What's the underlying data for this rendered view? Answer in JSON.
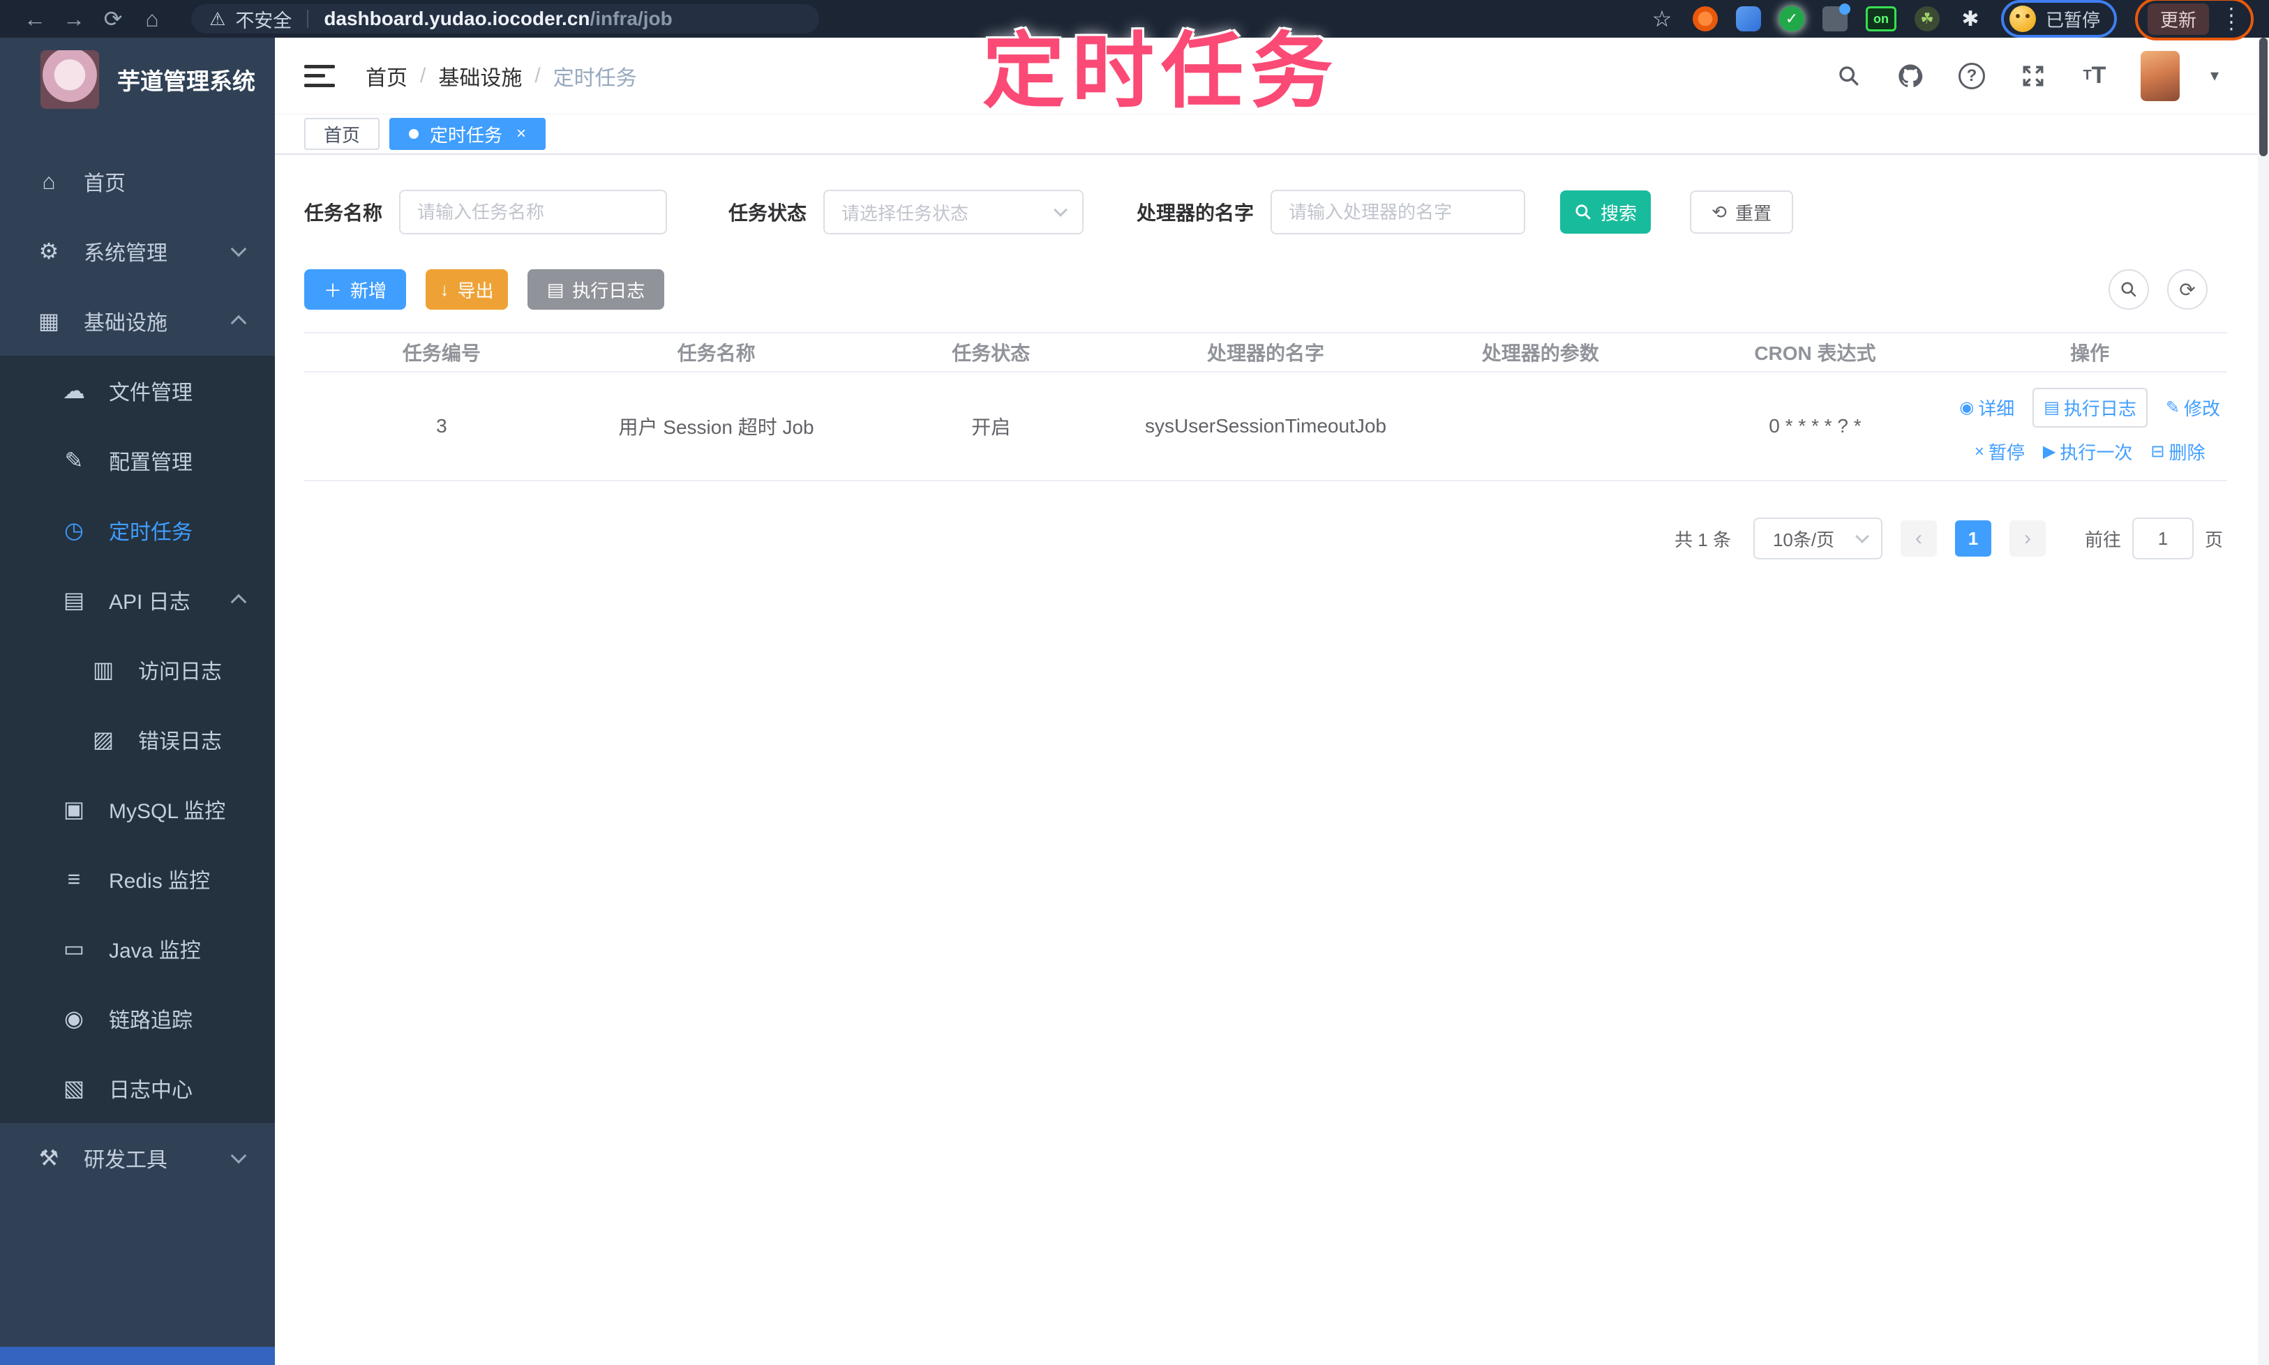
{
  "browser": {
    "security_label": "不安全",
    "url_host": "dashboard.yudao.iocoder.cn",
    "url_path": "/infra/job",
    "extension_badge": "on",
    "paused_label": "已暂停",
    "update_label": "更新"
  },
  "watermark": "定时任务",
  "sidebar": {
    "app_title": "芋道管理系统",
    "items": [
      {
        "label": "首页"
      },
      {
        "label": "系统管理"
      },
      {
        "label": "基础设施"
      },
      {
        "label": "文件管理"
      },
      {
        "label": "配置管理"
      },
      {
        "label": "定时任务"
      },
      {
        "label": "API 日志"
      },
      {
        "label": "访问日志"
      },
      {
        "label": "错误日志"
      },
      {
        "label": "MySQL 监控"
      },
      {
        "label": "Redis 监控"
      },
      {
        "label": "Java 监控"
      },
      {
        "label": "链路追踪"
      },
      {
        "label": "日志中心"
      },
      {
        "label": "研发工具"
      }
    ]
  },
  "header": {
    "breadcrumb": [
      "首页",
      "基础设施",
      "定时任务"
    ],
    "separator": "/"
  },
  "tabs": [
    {
      "label": "首页"
    },
    {
      "label": "定时任务"
    }
  ],
  "filters": {
    "name_label": "任务名称",
    "name_placeholder": "请输入任务名称",
    "status_label": "任务状态",
    "status_placeholder": "请选择任务状态",
    "handler_label": "处理器的名字",
    "handler_placeholder": "请输入处理器的名字",
    "search_label": "搜索",
    "reset_label": "重置"
  },
  "toolbar": {
    "add_label": "新增",
    "export_label": "导出",
    "log_label": "执行日志"
  },
  "table": {
    "columns": [
      "任务编号",
      "任务名称",
      "任务状态",
      "处理器的名字",
      "处理器的参数",
      "CRON 表达式",
      "操作"
    ],
    "row": {
      "id": "3",
      "name": "用户 Session 超时 Job",
      "status": "开启",
      "handler": "sysUserSessionTimeoutJob",
      "param": "",
      "cron": "0 * * * * ? *"
    },
    "actions": {
      "detail": "详细",
      "log": "执行日志",
      "edit": "修改",
      "pause": "暂停",
      "run": "执行一次",
      "remove": "删除"
    }
  },
  "pagination": {
    "total": "共 1 条",
    "page_size": "10条/页",
    "page": "1",
    "goto_label": "前往",
    "goto_value": "1",
    "unit_label": "页"
  }
}
